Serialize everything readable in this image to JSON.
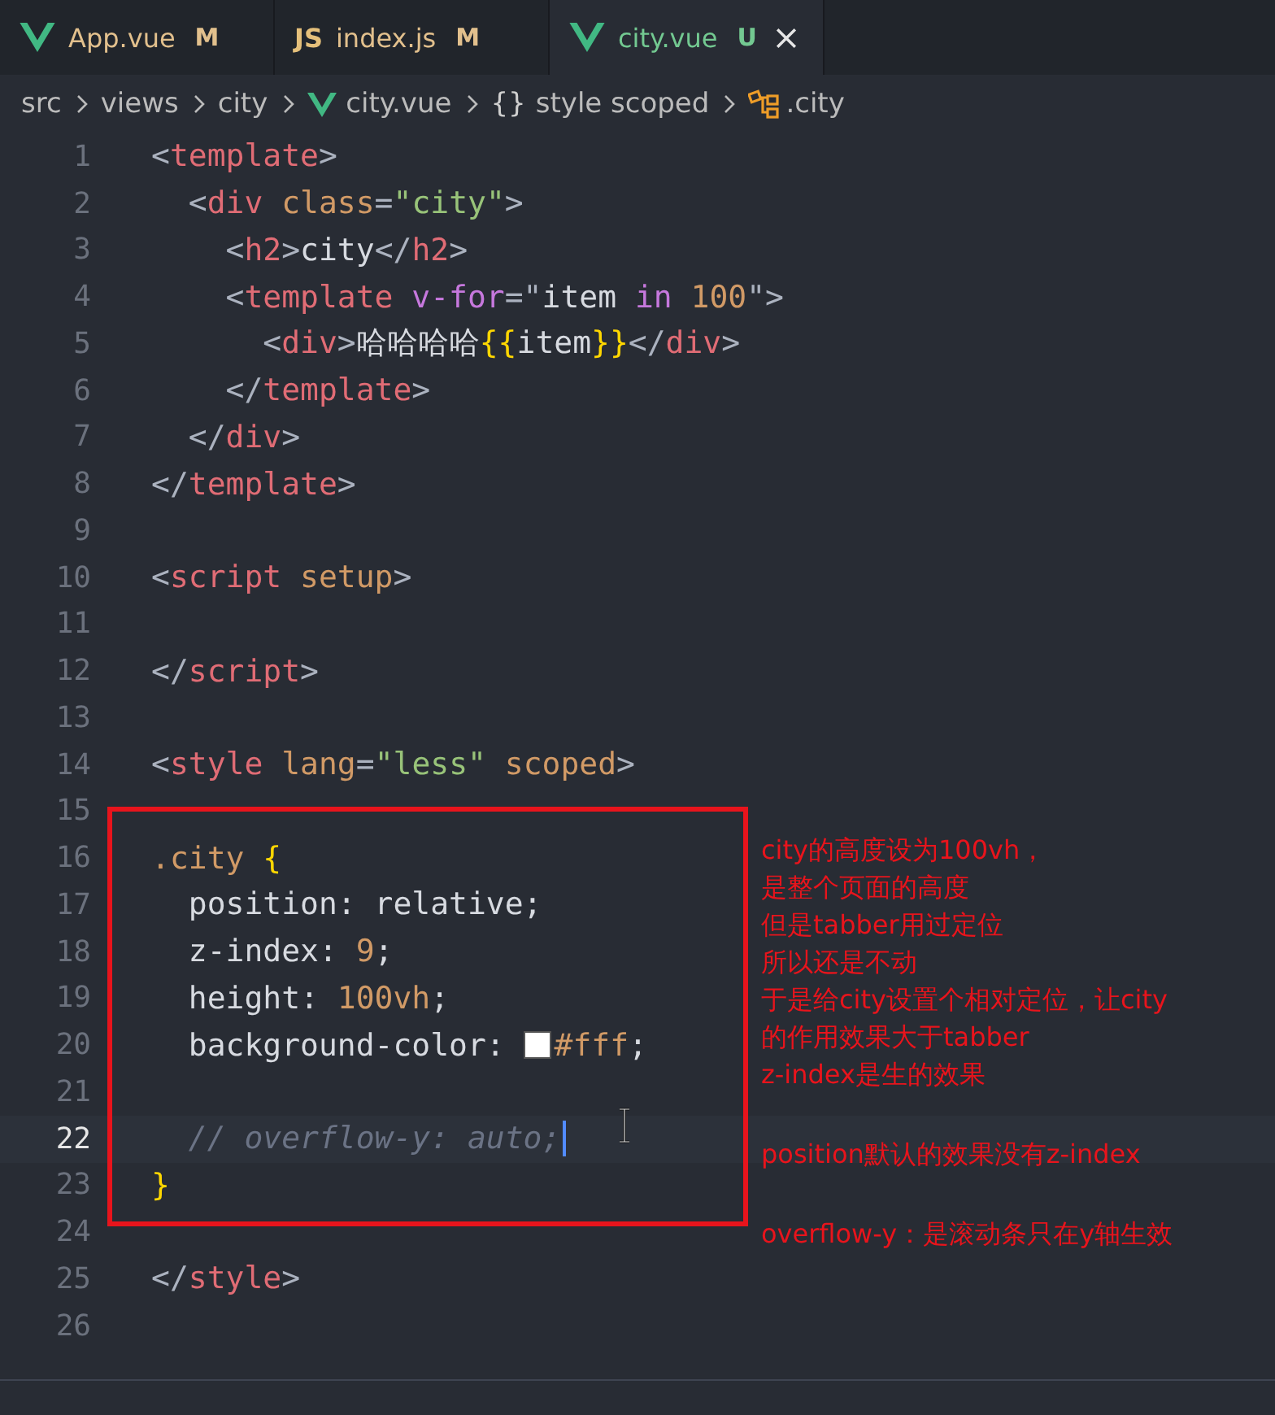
{
  "tabs": [
    {
      "kind": "vue",
      "label": "App.vue",
      "badge": "M",
      "color": "#e2c08d",
      "selected": false
    },
    {
      "kind": "js",
      "icon_text": "JS",
      "label": "index.js",
      "badge": "M",
      "color": "#e2c08d",
      "selected": false
    },
    {
      "kind": "vue",
      "label": "city.vue",
      "badge": "U",
      "color": "#73c991",
      "selected": true
    }
  ],
  "breadcrumb": [
    {
      "kind": "folder",
      "label": "src"
    },
    {
      "kind": "folder",
      "label": "views"
    },
    {
      "kind": "folder",
      "label": "city"
    },
    {
      "kind": "vue",
      "label": "city.vue"
    },
    {
      "kind": "braces",
      "icon_text": "{}",
      "label": "style scoped"
    },
    {
      "kind": "symbol",
      "label": ".city"
    }
  ],
  "lines": [
    {
      "number": "1",
      "current": false,
      "tokens": [
        {
          "kind": "punct",
          "text": "<"
        },
        {
          "kind": "tag",
          "text": "template"
        },
        {
          "kind": "punct",
          "text": ">"
        }
      ]
    },
    {
      "number": "2",
      "current": false,
      "tokens": [
        {
          "kind": "punct",
          "text": "  <"
        },
        {
          "kind": "tag",
          "text": "div"
        },
        {
          "kind": "attr",
          "text": " class"
        },
        {
          "kind": "punct",
          "text": "="
        },
        {
          "kind": "string",
          "text": "\"city\""
        },
        {
          "kind": "punct",
          "text": ">"
        }
      ]
    },
    {
      "number": "3",
      "current": false,
      "tokens": [
        {
          "kind": "punct",
          "text": "    <"
        },
        {
          "kind": "tag",
          "text": "h2"
        },
        {
          "kind": "punct",
          "text": ">"
        },
        {
          "kind": "text",
          "text": "city"
        },
        {
          "kind": "punct",
          "text": "</"
        },
        {
          "kind": "tag",
          "text": "h2"
        },
        {
          "kind": "punct",
          "text": ">"
        }
      ]
    },
    {
      "number": "4",
      "current": false,
      "tokens": [
        {
          "kind": "punct",
          "text": "    <"
        },
        {
          "kind": "tag",
          "text": "template"
        },
        {
          "kind": "keyword",
          "text": " v-for"
        },
        {
          "kind": "punct",
          "text": "=\""
        },
        {
          "kind": "text",
          "text": "item "
        },
        {
          "kind": "keyword",
          "text": "in"
        },
        {
          "kind": "number",
          "text": " 100"
        },
        {
          "kind": "punct",
          "text": "\">"
        }
      ]
    },
    {
      "number": "5",
      "current": false,
      "tokens": [
        {
          "kind": "punct",
          "text": "      <"
        },
        {
          "kind": "tag",
          "text": "div"
        },
        {
          "kind": "punct",
          "text": ">"
        },
        {
          "kind": "text",
          "text": "哈哈哈哈"
        },
        {
          "kind": "brace",
          "text": "{{"
        },
        {
          "kind": "text",
          "text": "item"
        },
        {
          "kind": "brace",
          "text": "}}"
        },
        {
          "kind": "punct",
          "text": "</"
        },
        {
          "kind": "tag",
          "text": "div"
        },
        {
          "kind": "punct",
          "text": ">"
        }
      ]
    },
    {
      "number": "6",
      "current": false,
      "tokens": [
        {
          "kind": "punct",
          "text": "    </"
        },
        {
          "kind": "tag",
          "text": "template"
        },
        {
          "kind": "punct",
          "text": ">"
        }
      ]
    },
    {
      "number": "7",
      "current": false,
      "tokens": [
        {
          "kind": "punct",
          "text": "  </"
        },
        {
          "kind": "tag",
          "text": "div"
        },
        {
          "kind": "punct",
          "text": ">"
        }
      ]
    },
    {
      "number": "8",
      "current": false,
      "tokens": [
        {
          "kind": "punct",
          "text": "</"
        },
        {
          "kind": "tag",
          "text": "template"
        },
        {
          "kind": "punct",
          "text": ">"
        }
      ]
    },
    {
      "number": "9",
      "current": false
    },
    {
      "number": "10",
      "current": false,
      "tokens": [
        {
          "kind": "punct",
          "text": "<"
        },
        {
          "kind": "tag",
          "text": "script"
        },
        {
          "kind": "attr",
          "text": " setup"
        },
        {
          "kind": "punct",
          "text": ">"
        }
      ]
    },
    {
      "number": "11",
      "current": false
    },
    {
      "number": "12",
      "current": false,
      "tokens": [
        {
          "kind": "punct",
          "text": "</"
        },
        {
          "kind": "tag",
          "text": "script"
        },
        {
          "kind": "punct",
          "text": ">"
        }
      ]
    },
    {
      "number": "13",
      "current": false
    },
    {
      "number": "14",
      "current": false,
      "tokens": [
        {
          "kind": "punct",
          "text": "<"
        },
        {
          "kind": "tag",
          "text": "style"
        },
        {
          "kind": "attr",
          "text": " lang"
        },
        {
          "kind": "punct",
          "text": "="
        },
        {
          "kind": "string",
          "text": "\"less\""
        },
        {
          "kind": "attr",
          "text": " scoped"
        },
        {
          "kind": "punct",
          "text": ">"
        }
      ]
    },
    {
      "number": "15",
      "current": false
    },
    {
      "number": "16",
      "current": false,
      "tokens": [
        {
          "kind": "attr",
          "text": ".city "
        },
        {
          "kind": "brace",
          "text": "{"
        }
      ]
    },
    {
      "number": "17",
      "current": false,
      "tokens": [
        {
          "kind": "text",
          "text": "  position: relative;"
        }
      ]
    },
    {
      "number": "18",
      "current": false,
      "tokens": [
        {
          "kind": "text",
          "text": "  z-index: "
        },
        {
          "kind": "number",
          "text": "9"
        },
        {
          "kind": "text",
          "text": ";"
        }
      ]
    },
    {
      "number": "19",
      "current": false,
      "tokens": [
        {
          "kind": "text",
          "text": "  height: "
        },
        {
          "kind": "number",
          "text": "100vh"
        },
        {
          "kind": "text",
          "text": ";"
        }
      ]
    },
    {
      "number": "20",
      "current": false,
      "tokens": [
        {
          "kind": "text",
          "text": "  background-color: "
        },
        {
          "kind": "swatch",
          "color": "#ffffff"
        },
        {
          "kind": "number",
          "text": "#fff"
        },
        {
          "kind": "text",
          "text": ";"
        }
      ]
    },
    {
      "number": "21",
      "current": false
    },
    {
      "number": "22",
      "current": true,
      "tokens": [
        {
          "kind": "comment",
          "text": "  // overflow-y: auto;"
        }
      ]
    },
    {
      "number": "23",
      "current": false,
      "tokens": [
        {
          "kind": "brace",
          "text": "}"
        }
      ]
    },
    {
      "number": "24",
      "current": false
    },
    {
      "number": "25",
      "current": false,
      "tokens": [
        {
          "kind": "punct",
          "text": "</"
        },
        {
          "kind": "tag",
          "text": "style"
        },
        {
          "kind": "punct",
          "text": ">"
        }
      ]
    },
    {
      "number": "26",
      "current": false
    }
  ],
  "notes": [
    [
      "city的高度设为100vh，",
      "是整个页面的高度",
      "但是tabber用过定位",
      "所以还是不动",
      "于是给city设置个相对定位，让city",
      "的作用效果大于tabber",
      "z-index是生的效果"
    ],
    [
      "position默认的效果没有z-index"
    ],
    [
      "overflow-y：是滚动条只在y轴生效"
    ]
  ]
}
